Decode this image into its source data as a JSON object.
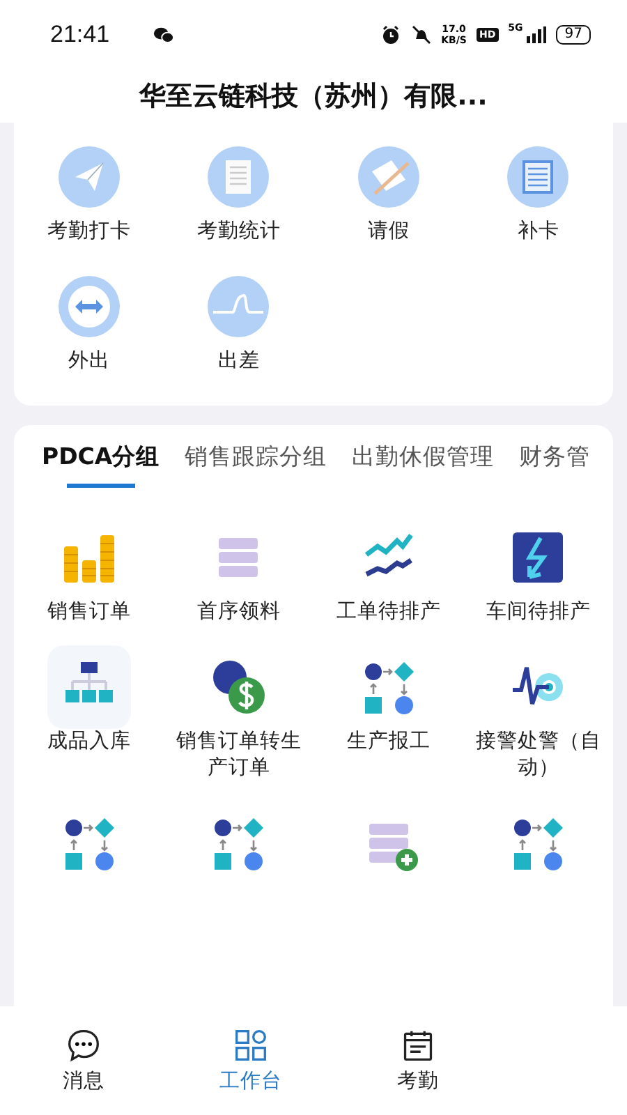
{
  "status_bar": {
    "time": "21:41",
    "speed": "17.0",
    "speed_unit": "KB/S",
    "hd": "HD",
    "network": "5G",
    "battery": "97"
  },
  "header": {
    "title": "华至云链科技（苏州）有限..."
  },
  "attendance": [
    {
      "label": "考勤打卡",
      "kind": "plane"
    },
    {
      "label": "考勤统计",
      "kind": "doc"
    },
    {
      "label": "请假",
      "kind": "pencil"
    },
    {
      "label": "补卡",
      "kind": "note"
    },
    {
      "label": "外出",
      "kind": "arrows"
    },
    {
      "label": "出差",
      "kind": "wave"
    }
  ],
  "groups": {
    "tabs": [
      {
        "label": "PDCA分组",
        "selected": true
      },
      {
        "label": "销售跟踪分组",
        "selected": false
      },
      {
        "label": "出勤休假管理",
        "selected": false
      },
      {
        "label": "财务管",
        "selected": false
      }
    ],
    "items": [
      {
        "label": "销售订单",
        "kind": "coins"
      },
      {
        "label": "首序领料",
        "kind": "stack"
      },
      {
        "label": "工单待排产",
        "kind": "lines"
      },
      {
        "label": "车间待排产",
        "kind": "bolt"
      },
      {
        "label": "成品入库",
        "kind": "org"
      },
      {
        "label": "销售订单转生产订单",
        "kind": "currency"
      },
      {
        "label": "生产报工",
        "kind": "flow"
      },
      {
        "label": "接警处警（自动）",
        "kind": "pulse"
      },
      {
        "kind": "flow"
      },
      {
        "kind": "flow"
      },
      {
        "kind": "stackplus"
      },
      {
        "kind": "flow"
      }
    ]
  },
  "bottom_nav": [
    {
      "label": "消息",
      "kind": "chat",
      "selected": false
    },
    {
      "label": "工作台",
      "kind": "grid",
      "selected": true
    },
    {
      "label": "考勤",
      "kind": "calendar",
      "selected": false
    }
  ]
}
